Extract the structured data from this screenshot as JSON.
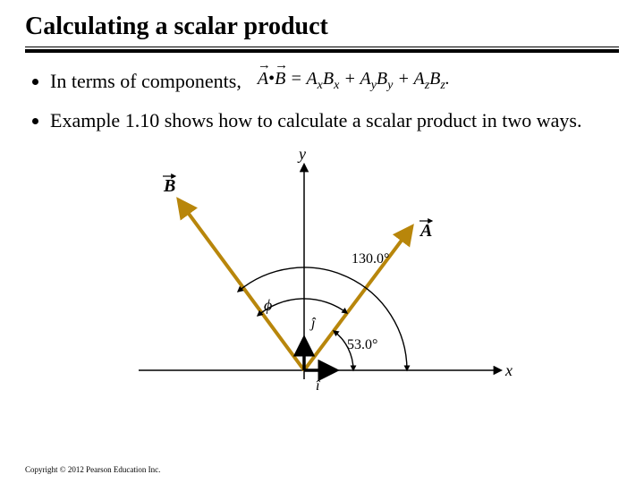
{
  "title": "Calculating a scalar product",
  "bullets": {
    "b1_text": "In terms of components,",
    "b2_text": "Example 1.10 shows how to calculate a scalar product in two ways."
  },
  "formula_html": "<span class=\"vec\">A</span><span class=\"dot\">•</span><span class=\"vec\">B</span> = A<sub>x</sub>B<sub>x</sub> + A<sub>y</sub>B<sub>y</sub> + A<sub>z</sub>B<sub>z</sub>.",
  "diagram": {
    "axis_y": "y",
    "axis_x": "x",
    "vecA": "A",
    "vecB": "B",
    "phi": "ϕ",
    "angle_big": "130.0°",
    "angle_small": "53.0°",
    "unit_i": "î",
    "unit_j": "ĵ"
  },
  "copyright": "Copyright © 2012 Pearson Education Inc."
}
